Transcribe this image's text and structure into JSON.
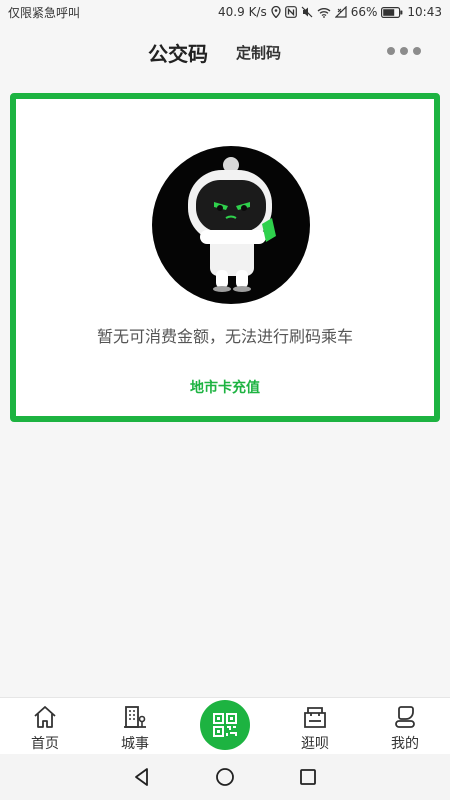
{
  "status_bar": {
    "left_text": "仅限紧急呼叫",
    "net_speed": "40.9 K/s",
    "battery": "66%",
    "time": "10:43"
  },
  "header": {
    "title": "公交码",
    "subtitle": "定制码",
    "more_icon": "more-dots-icon"
  },
  "card": {
    "border_color": "#1db341",
    "illustration": "robot-mascot",
    "message": "暂无可消费金额，无法进行刷码乘车",
    "action_label": "地市卡充值"
  },
  "tabs": [
    {
      "label": "首页",
      "icon": "home-icon"
    },
    {
      "label": "城事",
      "icon": "city-building-icon"
    },
    {
      "label": "",
      "icon": "qr-code-icon"
    },
    {
      "label": "逛呗",
      "icon": "shop-icon"
    },
    {
      "label": "我的",
      "icon": "profile-icon"
    }
  ],
  "colors": {
    "accent": "#1db341",
    "background": "#f6f6f6"
  }
}
